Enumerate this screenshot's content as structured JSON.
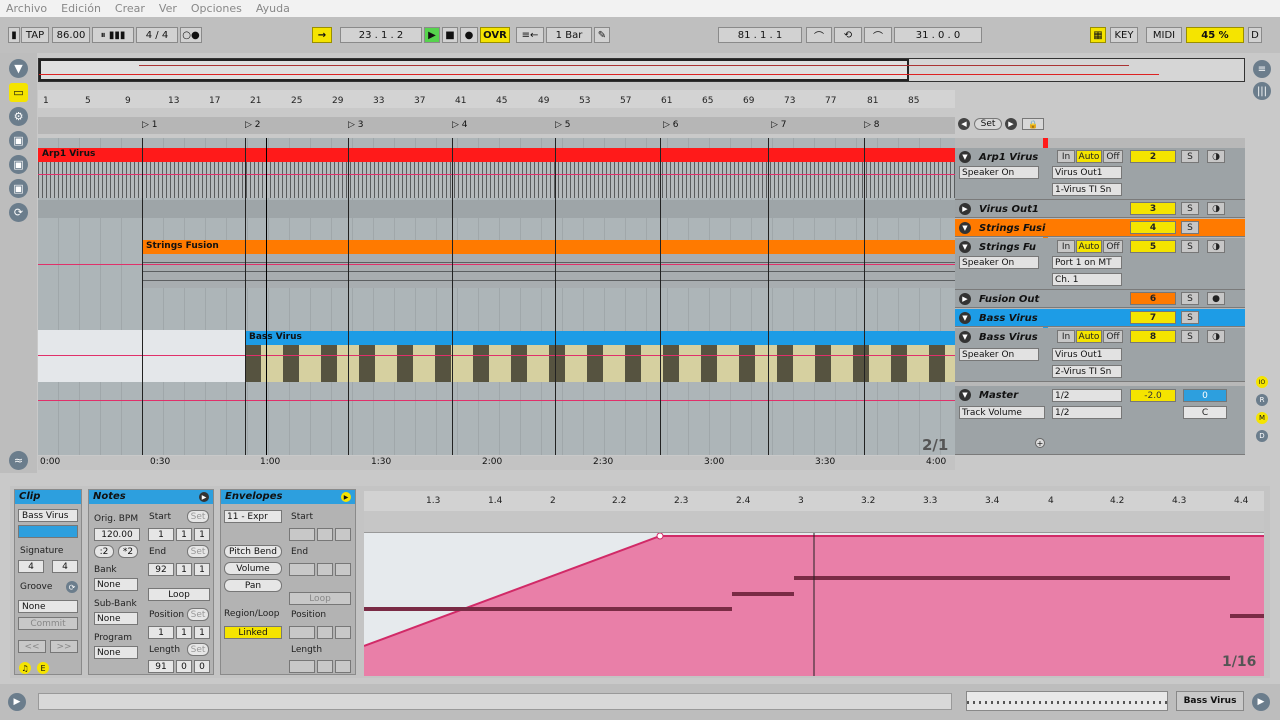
{
  "menu": [
    "Archivo",
    "Edición",
    "Crear",
    "Ver",
    "Opciones",
    "Ayuda"
  ],
  "transport": {
    "tap": "TAP",
    "bpm": "86.00",
    "sig": "4 / 4",
    "pos": "23 . 1 . 2",
    "ovr": "OVR",
    "quant": "1 Bar",
    "loopstart": "81 . 1 . 1",
    "looplen": "31 . 0 . 0",
    "key": "KEY",
    "midi": "MIDI",
    "cpu": "45 %",
    "d": "D"
  },
  "ruler": [
    "1",
    "5",
    "9",
    "13",
    "17",
    "21",
    "25",
    "29",
    "33",
    "37",
    "41",
    "45",
    "49",
    "53",
    "57",
    "61",
    "65",
    "69",
    "73",
    "77",
    "81",
    "85"
  ],
  "locators": [
    "1",
    "2",
    "3",
    "4",
    "5",
    "6",
    "7",
    "8"
  ],
  "set_label": "Set",
  "clips": {
    "arp": "Arp1 Virus",
    "strings": "Strings Fusion",
    "bass": "Bass Virus"
  },
  "tracks": [
    {
      "name": "Arp1 Virus",
      "in": "In",
      "auto": "Auto",
      "off": "Off",
      "num": "2",
      "s": "S",
      "out1": "Speaker On",
      "route1": "Virus Out1",
      "route2": "1-Virus TI Sn"
    },
    {
      "name": "Virus Out1",
      "num": "3",
      "s": "S"
    },
    {
      "name": "Strings Fusi",
      "num": "4",
      "s": "S"
    },
    {
      "name": "Strings Fu",
      "in": "In",
      "auto": "Auto",
      "off": "Off",
      "num": "5",
      "s": "S",
      "out1": "Speaker On",
      "route1": "Port 1 on MT",
      "route2": "Ch. 1"
    },
    {
      "name": "Fusion Out",
      "num": "6",
      "s": "S"
    },
    {
      "name": "Bass Virus",
      "num": "7",
      "s": "S"
    },
    {
      "name": "Bass Virus",
      "in": "In",
      "auto": "Auto",
      "off": "Off",
      "num": "8",
      "s": "S",
      "out1": "Speaker On",
      "route1": "Virus Out1",
      "route2": "2-Virus TI Sn"
    }
  ],
  "master": {
    "name": "Master",
    "r1": "1/2",
    "r2": "1/2",
    "tv": "Track Volume",
    "vol": "-2.0",
    "val": "0",
    "c": "C"
  },
  "zoom": "2/1",
  "time": [
    "0:00",
    "0:30",
    "1:00",
    "1:30",
    "2:00",
    "2:30",
    "3:00",
    "3:30",
    "4:00"
  ],
  "clip": {
    "title": "Clip",
    "name": "Bass Virus",
    "signature": "Signature",
    "sig_n": "4",
    "sig_d": "4",
    "groove": "Groove",
    "groove_v": "None",
    "commit": "Commit"
  },
  "notes": {
    "title": "Notes",
    "orig_bpm": "Orig. BPM",
    "bpm": "120.00",
    "bank": "Bank",
    "bank_v": "None",
    "subbank": "Sub-Bank",
    "sub_v": "None",
    "program": "Program",
    "prog_v": "None",
    "start": "Start",
    "start_v": [
      "1",
      "1",
      "1"
    ],
    "end": "End",
    "end_v": [
      "92",
      "1",
      "1"
    ],
    "loop": "Loop",
    "position": "Position",
    "pos_v": [
      "1",
      "1",
      "1"
    ],
    "length": "Length",
    "len_v": [
      "91",
      "0",
      "0"
    ],
    "set": "Set",
    "half": ":2",
    "dbl": "*2"
  },
  "env": {
    "title": "Envelopes",
    "ctrl": "11 - Expr",
    "pb": "Pitch Bend",
    "vol": "Volume",
    "pan": "Pan",
    "rl": "Region/Loop",
    "linked": "Linked",
    "start": "Start",
    "end": "End",
    "loop": "Loop",
    "position": "Position",
    "length": "Length"
  },
  "piano_ruler": [
    "1.3",
    "1.4",
    "2",
    "2.2",
    "2.3",
    "2.4",
    "3",
    "3.2",
    "3.3",
    "3.4",
    "4",
    "4.2",
    "4.3",
    "4.4"
  ],
  "piano_zoom": "1/16",
  "status": {
    "track": "Bass Virus"
  }
}
